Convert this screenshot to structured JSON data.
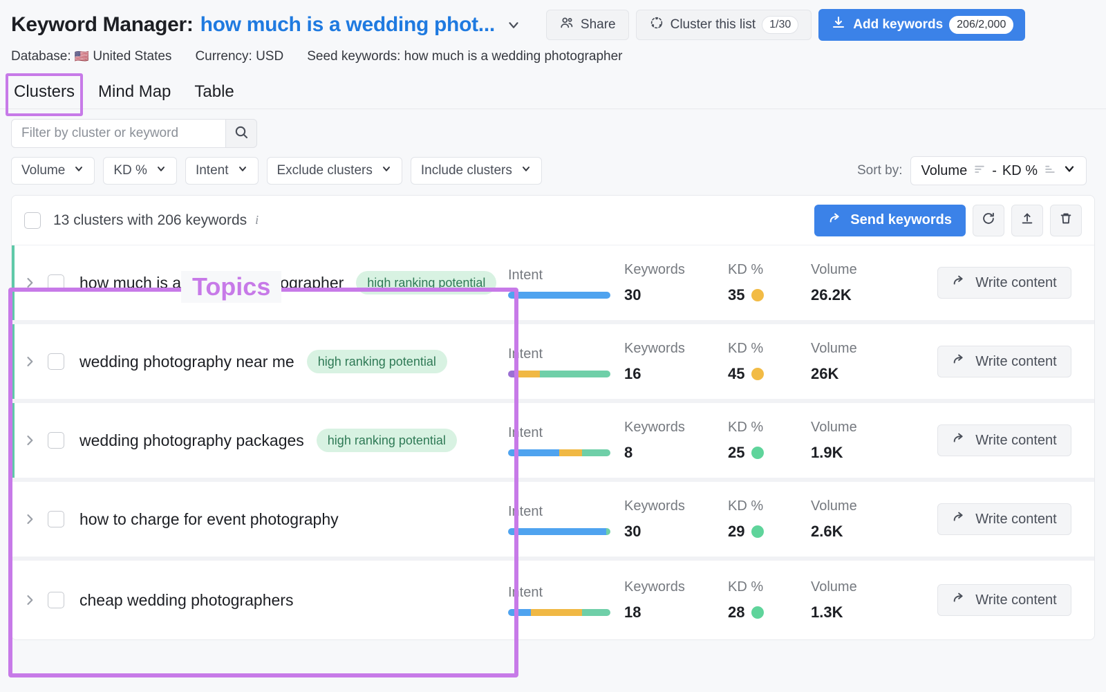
{
  "header": {
    "title_static": "Keyword Manager:",
    "title_link": "how much is a wedding phot...",
    "caret_icon": "chevron-down-icon",
    "share_label": "Share",
    "share_icon": "people-icon",
    "cluster_label": "Cluster this list",
    "cluster_icon": "cluster-icon",
    "cluster_count": "1/30",
    "add_keywords_label": "Add keywords",
    "add_keywords_icon": "download-icon",
    "add_keywords_count": "206/2,000"
  },
  "subheader": {
    "database_label": "Database:",
    "database_value": "United States",
    "database_flag": "🇺🇸",
    "currency_label": "Currency:",
    "currency_value": "USD",
    "seed_label": "Seed keywords:",
    "seed_value": "how much is a wedding photographer"
  },
  "tabs": [
    {
      "label": "Clusters",
      "active": true
    },
    {
      "label": "Mind Map",
      "active": false
    },
    {
      "label": "Table",
      "active": false
    }
  ],
  "search": {
    "placeholder": "Filter by cluster or keyword",
    "value": "",
    "icon": "search-icon"
  },
  "filters": [
    {
      "label": "Volume",
      "icon": "chevron-down-icon"
    },
    {
      "label": "KD %",
      "icon": "chevron-down-icon"
    },
    {
      "label": "Intent",
      "icon": "chevron-down-icon"
    },
    {
      "label": "Exclude clusters",
      "icon": "chevron-down-icon"
    },
    {
      "label": "Include clusters",
      "icon": "chevron-down-icon"
    }
  ],
  "sort": {
    "label": "Sort by:",
    "primary": "Volume",
    "separator": "-",
    "secondary": "KD %",
    "icon": "chevron-down-icon"
  },
  "toolbar": {
    "summary": "13 clusters with 206 keywords",
    "info_icon": "info-icon",
    "send_label": "Send keywords",
    "send_icon": "arrow-forward-icon",
    "refresh_icon": "refresh-icon",
    "export_icon": "export-icon",
    "delete_icon": "trash-icon"
  },
  "columns": {
    "intent": "Intent",
    "keywords": "Keywords",
    "kd": "KD %",
    "volume": "Volume"
  },
  "write_content_label": "Write content",
  "write_content_icon": "arrow-forward-icon",
  "badge_label": "high ranking potential",
  "annotations": {
    "topics_label": "Topics",
    "annotation_color": "#c77ae8"
  },
  "colors": {
    "accent_blue": "#3b82e8",
    "intent_informational": "#4fa3ef",
    "intent_commercial": "#f0b844",
    "intent_transactional": "#5fc9a8",
    "intent_navigational": "#9b6fd4",
    "kd_easy": "#5fd49b",
    "kd_medium": "#f2bb45",
    "row_accent": "#5fc9a8",
    "badge_bg": "#d8f2e2",
    "badge_text": "#2f7a56"
  },
  "rows": [
    {
      "title": "how much is a wedding photographer",
      "badge": "high ranking potential",
      "accent": true,
      "intent_segments": [
        {
          "color": "#4fa3ef",
          "pct": 100
        }
      ],
      "keywords": "30",
      "kd": "35",
      "kd_color": "#f2bb45",
      "volume": "26.2K"
    },
    {
      "title": "wedding photography near me",
      "badge": "high ranking potential",
      "accent": true,
      "intent_segments": [
        {
          "color": "#9b6fd4",
          "pct": 9
        },
        {
          "color": "#f0b844",
          "pct": 22
        },
        {
          "color": "#6fcfa8",
          "pct": 69
        }
      ],
      "keywords": "16",
      "kd": "45",
      "kd_color": "#f2bb45",
      "volume": "26K"
    },
    {
      "title": "wedding photography packages",
      "badge": "high ranking potential",
      "accent": true,
      "intent_segments": [
        {
          "color": "#4fa3ef",
          "pct": 50
        },
        {
          "color": "#f0b844",
          "pct": 22
        },
        {
          "color": "#6fcfa8",
          "pct": 28
        }
      ],
      "keywords": "8",
      "kd": "25",
      "kd_color": "#5fd49b",
      "volume": "1.9K"
    },
    {
      "title": "how to charge for event photography",
      "badge": "",
      "accent": false,
      "intent_segments": [
        {
          "color": "#4fa3ef",
          "pct": 96
        },
        {
          "color": "#6fcfa8",
          "pct": 4
        }
      ],
      "keywords": "30",
      "kd": "29",
      "kd_color": "#5fd49b",
      "volume": "2.6K"
    },
    {
      "title": "cheap wedding photographers",
      "badge": "",
      "accent": false,
      "intent_segments": [
        {
          "color": "#4fa3ef",
          "pct": 22
        },
        {
          "color": "#f0b844",
          "pct": 50
        },
        {
          "color": "#6fcfa8",
          "pct": 28
        }
      ],
      "keywords": "18",
      "kd": "28",
      "kd_color": "#5fd49b",
      "volume": "1.3K"
    }
  ]
}
